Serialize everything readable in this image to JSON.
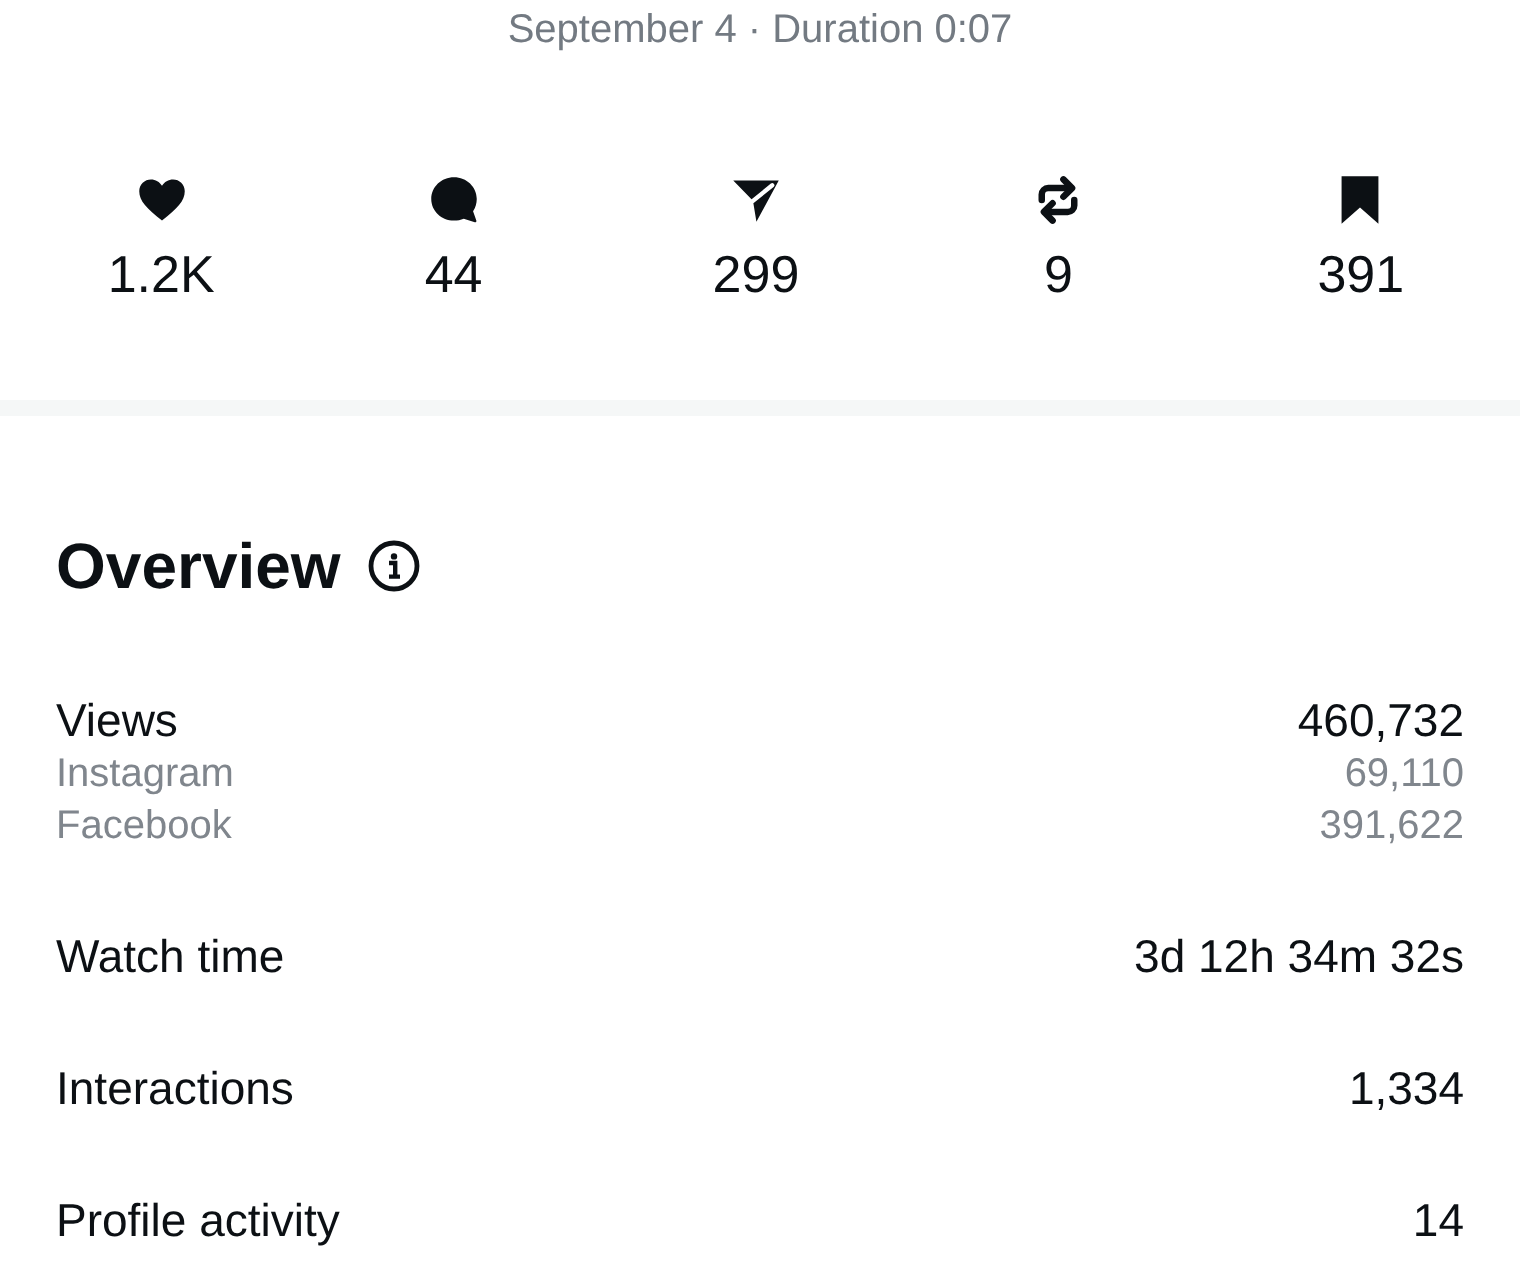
{
  "header": {
    "subtitle": "September 4 · Duration 0:07"
  },
  "stats": [
    {
      "kind": "likes",
      "value": "1.2K"
    },
    {
      "kind": "comments",
      "value": "44"
    },
    {
      "kind": "shares",
      "value": "299"
    },
    {
      "kind": "reposts",
      "value": "9"
    },
    {
      "kind": "saves",
      "value": "391"
    }
  ],
  "overview": {
    "title": "Overview",
    "metrics": [
      {
        "label": "Views",
        "value": "460,732",
        "breakdown": [
          {
            "label": "Instagram",
            "value": "69,110"
          },
          {
            "label": "Facebook",
            "value": "391,622"
          }
        ]
      },
      {
        "label": "Watch time",
        "value": "3d 12h 34m 32s"
      },
      {
        "label": "Interactions",
        "value": "1,334"
      },
      {
        "label": "Profile activity",
        "value": "14"
      }
    ]
  }
}
